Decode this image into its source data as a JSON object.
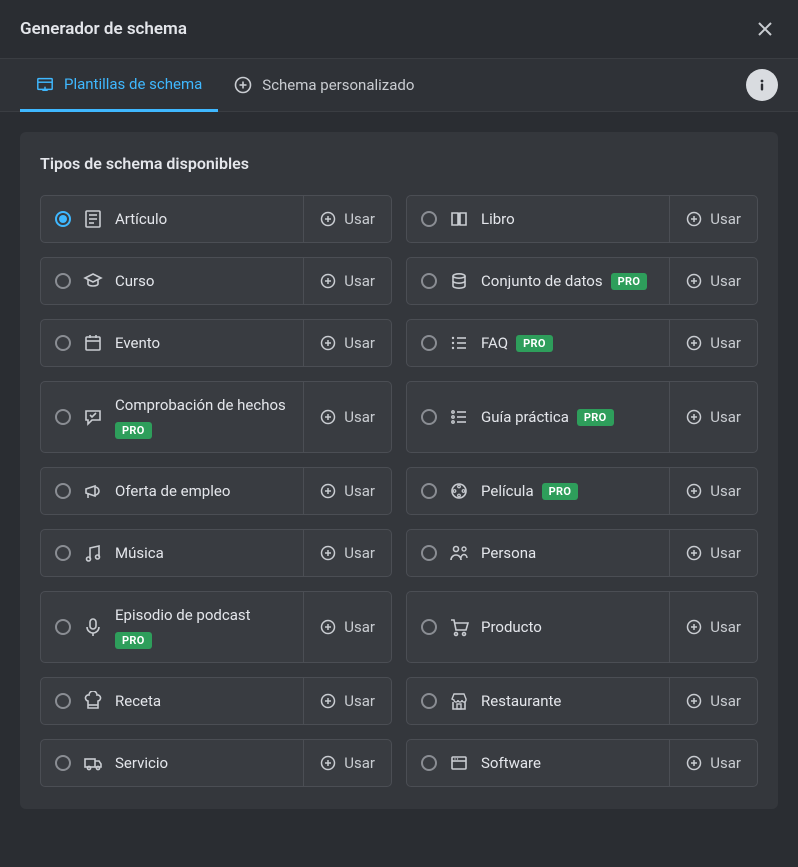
{
  "header": {
    "title": "Generador de schema"
  },
  "tabs": {
    "templates": "Plantillas de schema",
    "custom": "Schema personalizado"
  },
  "section": {
    "title": "Tipos de schema disponibles"
  },
  "badges": {
    "pro": "PRO"
  },
  "use_label": "Usar",
  "types": [
    {
      "id": "article",
      "label": "Artículo",
      "icon": "article",
      "pro": false,
      "selected": true,
      "multiline": false
    },
    {
      "id": "book",
      "label": "Libro",
      "icon": "book",
      "pro": false,
      "selected": false,
      "multiline": false
    },
    {
      "id": "course",
      "label": "Curso",
      "icon": "course",
      "pro": false,
      "selected": false,
      "multiline": false
    },
    {
      "id": "dataset",
      "label": "Conjunto de datos",
      "icon": "database",
      "pro": true,
      "selected": false,
      "multiline": false
    },
    {
      "id": "event",
      "label": "Evento",
      "icon": "calendar",
      "pro": false,
      "selected": false,
      "multiline": false
    },
    {
      "id": "faq",
      "label": "FAQ",
      "icon": "list",
      "pro": true,
      "selected": false,
      "multiline": false
    },
    {
      "id": "factcheck",
      "label": "Comprobación de hechos",
      "icon": "chat-check",
      "pro": true,
      "selected": false,
      "multiline": true
    },
    {
      "id": "howto",
      "label": "Guía práctica",
      "icon": "steps",
      "pro": true,
      "selected": false,
      "multiline": false
    },
    {
      "id": "jobposting",
      "label": "Oferta de empleo",
      "icon": "megaphone",
      "pro": false,
      "selected": false,
      "multiline": false
    },
    {
      "id": "movie",
      "label": "Película",
      "icon": "film",
      "pro": true,
      "selected": false,
      "multiline": false
    },
    {
      "id": "music",
      "label": "Música",
      "icon": "music",
      "pro": false,
      "selected": false,
      "multiline": false
    },
    {
      "id": "person",
      "label": "Persona",
      "icon": "person",
      "pro": false,
      "selected": false,
      "multiline": false
    },
    {
      "id": "podcast",
      "label": "Episodio de podcast",
      "icon": "mic",
      "pro": true,
      "selected": false,
      "multiline": true
    },
    {
      "id": "product",
      "label": "Producto",
      "icon": "cart",
      "pro": false,
      "selected": false,
      "multiline": false
    },
    {
      "id": "recipe",
      "label": "Receta",
      "icon": "chef",
      "pro": false,
      "selected": false,
      "multiline": false
    },
    {
      "id": "restaurant",
      "label": "Restaurante",
      "icon": "store",
      "pro": false,
      "selected": false,
      "multiline": false
    },
    {
      "id": "service",
      "label": "Servicio",
      "icon": "truck",
      "pro": false,
      "selected": false,
      "multiline": false
    },
    {
      "id": "software",
      "label": "Software",
      "icon": "window",
      "pro": false,
      "selected": false,
      "multiline": false
    }
  ]
}
